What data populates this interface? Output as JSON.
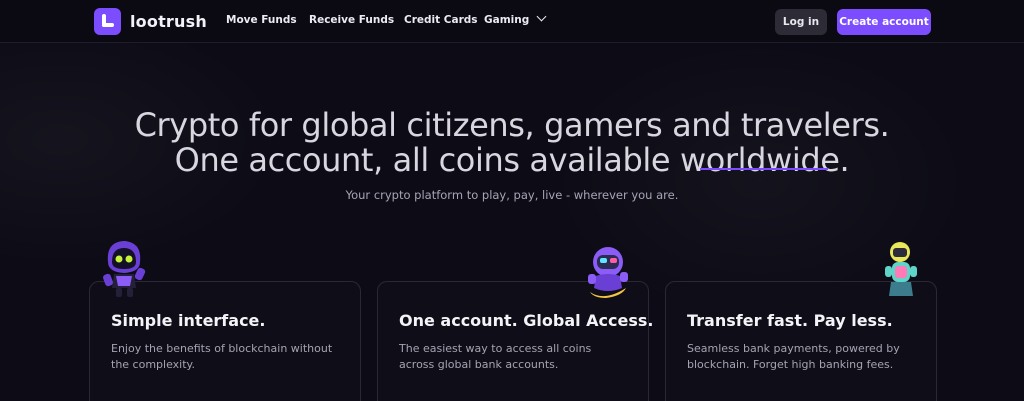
{
  "brand": {
    "name": "lootrush",
    "accent": "#7b4dff"
  },
  "nav": {
    "links": [
      "Move Funds",
      "Receive Funds",
      "Credit Cards",
      "Gaming"
    ],
    "login_label": "Log in",
    "create_label": "Create account"
  },
  "hero": {
    "line1": "Crypto for global citizens, gamers and travelers.",
    "line2": "One account, all coins available worldwide.",
    "subtitle": "Your crypto platform to play, pay, live - wherever you are."
  },
  "cards": [
    {
      "title": "Simple interface.",
      "desc": "Enjoy the benefits of blockchain without the complexity.",
      "mascot": "robot-mascot-icon"
    },
    {
      "title": "One account. Global Access.",
      "desc": "The easiest way to access all coins across global bank accounts.",
      "mascot": "astronaut-mascot-icon"
    },
    {
      "title": "Transfer fast. Pay less.",
      "desc": "Seamless bank payments, powered by blockchain. Forget high banking fees.",
      "mascot": "diver-mascot-icon"
    }
  ]
}
